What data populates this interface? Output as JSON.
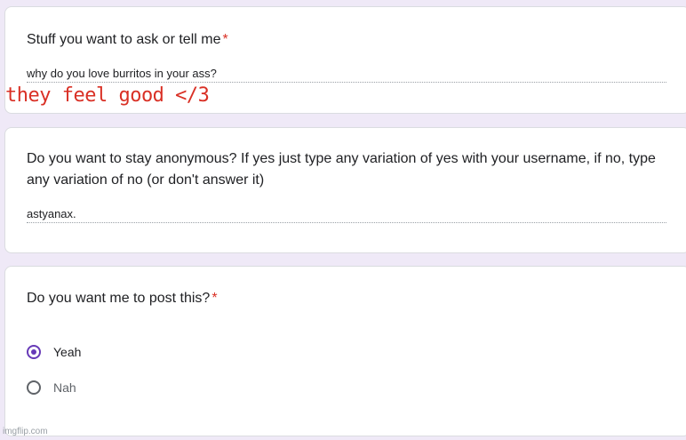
{
  "q1": {
    "title": "Stuff you want to ask or tell me",
    "required_mark": "*",
    "answer": "why do you love burritos in your ass?"
  },
  "overlay_handwritten": "they feel good </3",
  "q2": {
    "title_line1": "Do you want to stay anonymous? If yes just type any variation of yes with your username, if no, type",
    "title_line2": "any variation of no (or don't answer it)",
    "answer": "astyanax."
  },
  "q3": {
    "title": "Do you want me to post this?",
    "required_mark": "*",
    "options": [
      {
        "label": "Yeah",
        "selected": true
      },
      {
        "label": "Nah",
        "selected": false
      }
    ]
  },
  "watermark": "imgflip.com",
  "colors": {
    "accent": "#673ab7",
    "required": "#d93025",
    "background": "#efe9f7"
  }
}
